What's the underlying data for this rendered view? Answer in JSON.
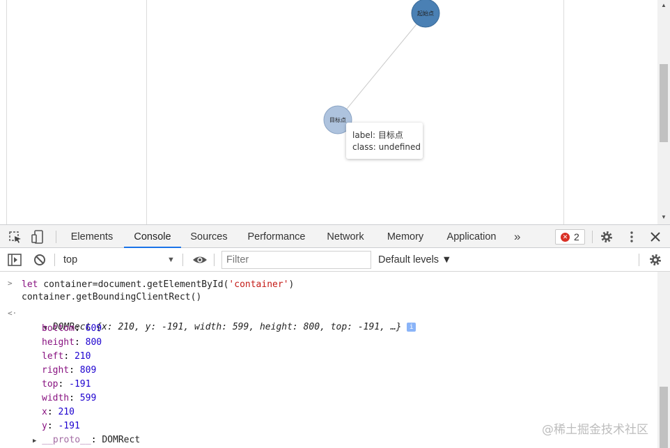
{
  "graph": {
    "source_node_label": "起始点",
    "target_node_label": "目标点",
    "source_node_color": "#4a80b4",
    "target_node_color": "#aec3de",
    "tooltip": {
      "line1": "label: 目标点",
      "line2": "class: undefined"
    }
  },
  "devtools": {
    "tabs": [
      "Elements",
      "Console",
      "Sources",
      "Performance",
      "Network",
      "Memory",
      "Application"
    ],
    "active_tab": "Console",
    "more_tabs_icon": "»",
    "error_count": "2",
    "context": "top",
    "filter_placeholder": "Filter",
    "log_levels": "Default levels ▼"
  },
  "console": {
    "input_line1_kw": "let",
    "input_line1_pre": " container=document.getElementById(",
    "input_line1_str": "'container'",
    "input_line1_post": ")",
    "input_line2": "container.getBoundingClientRect()",
    "result_summary": "DOMRect {x: 210, y: -191, width: 599, height: 800, top: -191, …}",
    "properties": [
      {
        "key": "bottom",
        "value": "609"
      },
      {
        "key": "height",
        "value": "800"
      },
      {
        "key": "left",
        "value": "210"
      },
      {
        "key": "right",
        "value": "809"
      },
      {
        "key": "top",
        "value": "-191"
      },
      {
        "key": "width",
        "value": "599"
      },
      {
        "key": "x",
        "value": "210"
      },
      {
        "key": "y",
        "value": "-191"
      }
    ],
    "proto_key": "__proto__",
    "proto_value": "DOMRect"
  },
  "watermark": "@稀土掘金技术社区"
}
